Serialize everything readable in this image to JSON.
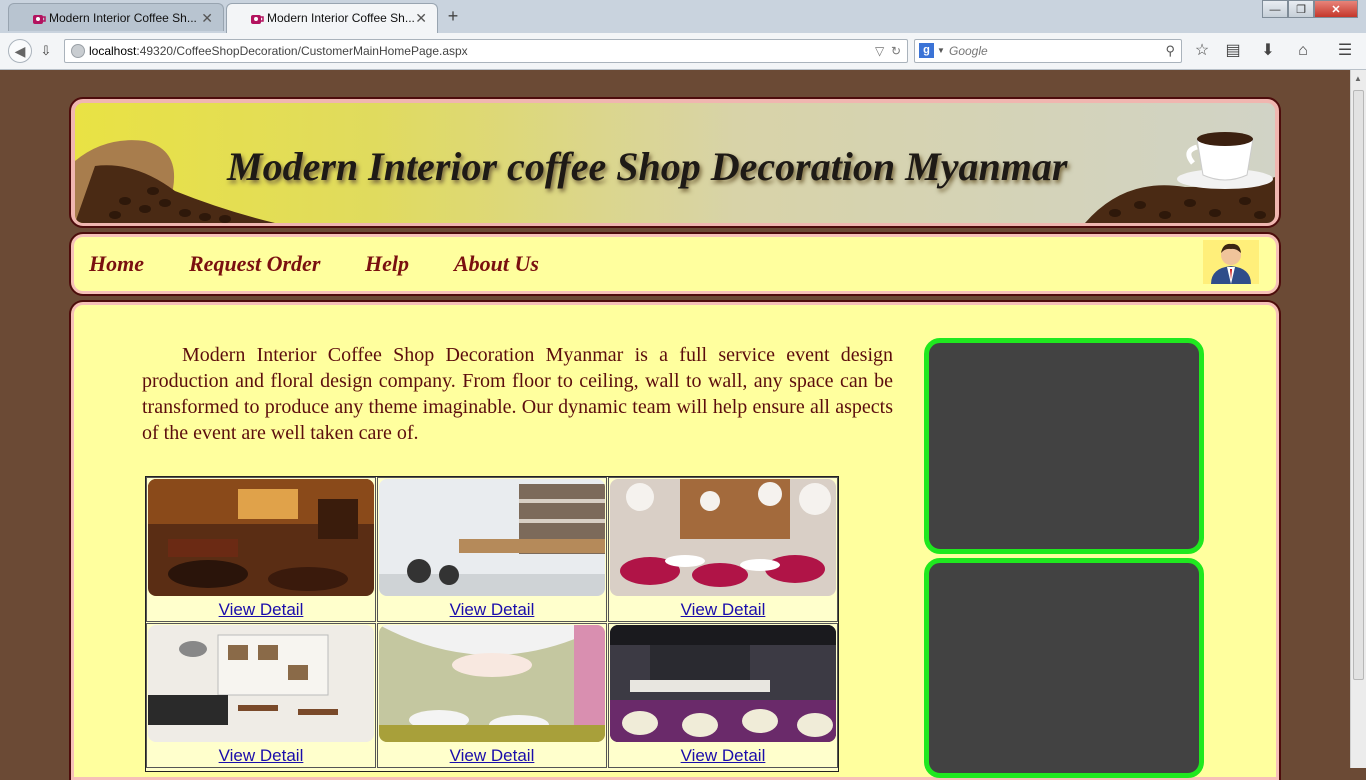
{
  "browser": {
    "tabs": [
      {
        "title": "Modern Interior Coffee Sh...",
        "active": false
      },
      {
        "title": "Modern Interior Coffee Sh...",
        "active": true
      }
    ],
    "new_tab": "+",
    "url_host": "localhost",
    "url_rest": ":49320/CoffeeShopDecoration/CustomerMainHomePage.aspx",
    "search_placeholder": "Google",
    "window_buttons": {
      "minimize": "—",
      "maximize": "❐",
      "close": "✕"
    }
  },
  "header": {
    "title": "Modern Interior coffee Shop Decoration Myanmar"
  },
  "menu": {
    "items": [
      "Home",
      "Request Order",
      "Help",
      "About Us"
    ]
  },
  "main": {
    "intro": "Modern Interior Coffee Shop Decoration Myanmar is a full service event design production and floral design company. From floor to ceiling, wall to wall, any space can be transformed to produce any theme imaginable. Our dynamic team will help ensure all aspects of the event are well taken care of.",
    "gallery": [
      {
        "link": "View Detail"
      },
      {
        "link": "View Detail"
      },
      {
        "link": "View Detail"
      },
      {
        "link": "View Detail"
      },
      {
        "link": "View Detail"
      },
      {
        "link": "View Detail"
      }
    ]
  },
  "colors": {
    "page_bg": "#6b4a35",
    "panel_yellow": "#ffff9e",
    "menu_text": "#7a1010",
    "side_panel_border": "#1fe81f",
    "link": "#1a0dab"
  }
}
